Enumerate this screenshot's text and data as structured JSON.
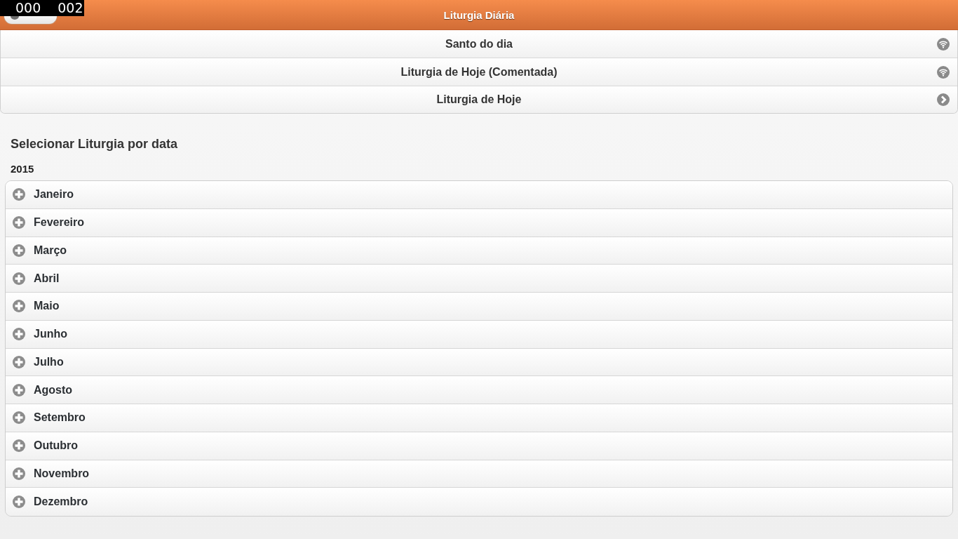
{
  "recording_counter": [
    "000",
    "002"
  ],
  "header": {
    "title": "Liturgia Diária"
  },
  "links": [
    {
      "label": "Santo do dia",
      "kind": "feed"
    },
    {
      "label": "Liturgia de Hoje (Comentada)",
      "kind": "feed"
    },
    {
      "label": "Liturgia de Hoje",
      "kind": "arrow"
    }
  ],
  "date_section": {
    "title": "Selecionar Liturgia por data",
    "year": "2015",
    "months": [
      {
        "label": "Janeiro",
        "expanded": false
      },
      {
        "label": "Fevereiro",
        "expanded": false
      },
      {
        "label": "Março",
        "expanded": false
      },
      {
        "label": "Abril",
        "expanded": false
      },
      {
        "label": "Maio",
        "expanded": false
      },
      {
        "label": "Junho",
        "expanded": false
      },
      {
        "label": "Julho",
        "expanded": false
      },
      {
        "label": "Agosto",
        "expanded": false
      },
      {
        "label": "Setembro",
        "expanded": false
      },
      {
        "label": "Outubro",
        "expanded": false
      },
      {
        "label": "Novembro",
        "expanded": false
      },
      {
        "label": "Dezembro",
        "expanded": false
      }
    ]
  }
}
